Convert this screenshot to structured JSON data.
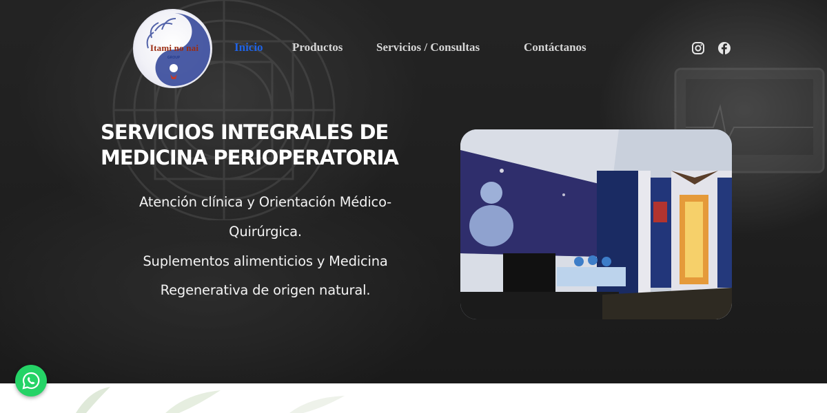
{
  "logo": {
    "name": "Itami no nai",
    "tagline": "GROUP"
  },
  "nav": {
    "items": [
      {
        "label": "Inicio",
        "active": true
      },
      {
        "label": "Productos",
        "active": false
      },
      {
        "label": "Servicios / Consultas",
        "active": false
      },
      {
        "label": "Contáctanos",
        "active": false
      }
    ]
  },
  "social": {
    "icons": [
      "instagram-icon",
      "facebook-icon"
    ]
  },
  "hero": {
    "headline_line1": "SERVICIOS INTEGRALES DE",
    "headline_line2": "MEDICINA PERIOPERATORIA",
    "body_lines": [
      "Atención clínica y Orientación Médico-",
      "Quirúrgica.",
      "Suplementos alimenticios y Medicina",
      "Regenerativa de origen natural."
    ]
  },
  "floating": {
    "icon": "whatsapp-icon"
  },
  "colors": {
    "nav_active": "#1f63e6",
    "nav_text": "#d6d6d6",
    "whatsapp": "#25d366",
    "logo_text": "#9b2d13"
  }
}
